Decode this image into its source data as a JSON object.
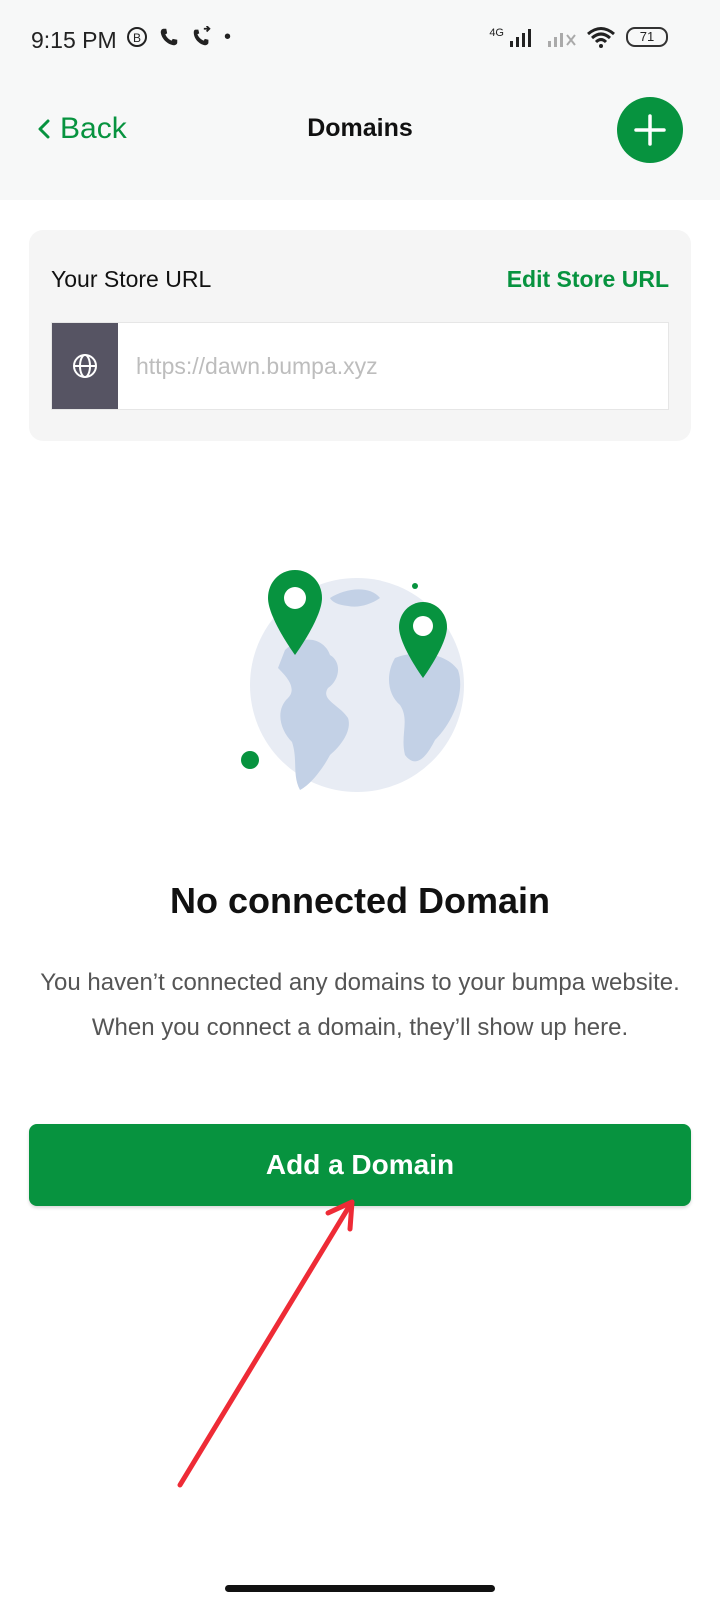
{
  "status_bar": {
    "time": "9:15 PM",
    "network": "4G",
    "battery": "71"
  },
  "header": {
    "back_label": "Back",
    "title": "Domains"
  },
  "store_url": {
    "label": "Your Store URL",
    "edit_label": "Edit Store URL",
    "url_placeholder": "https://dawn.bumpa.xyz"
  },
  "empty_state": {
    "title": "No connected Domain",
    "description": "You haven’t connected any domains to your bumpa website. When you connect a domain, they’ll show up here."
  },
  "actions": {
    "add_domain_label": "Add a Domain"
  },
  "colors": {
    "brand_green": "#07933f",
    "globe_fill": "#e8ecf4",
    "continents": "#c3d1e6",
    "annotation_red": "#ee2b36"
  },
  "icons": {
    "back": "chevron-left-icon",
    "add": "plus-icon",
    "globe": "globe-icon"
  }
}
